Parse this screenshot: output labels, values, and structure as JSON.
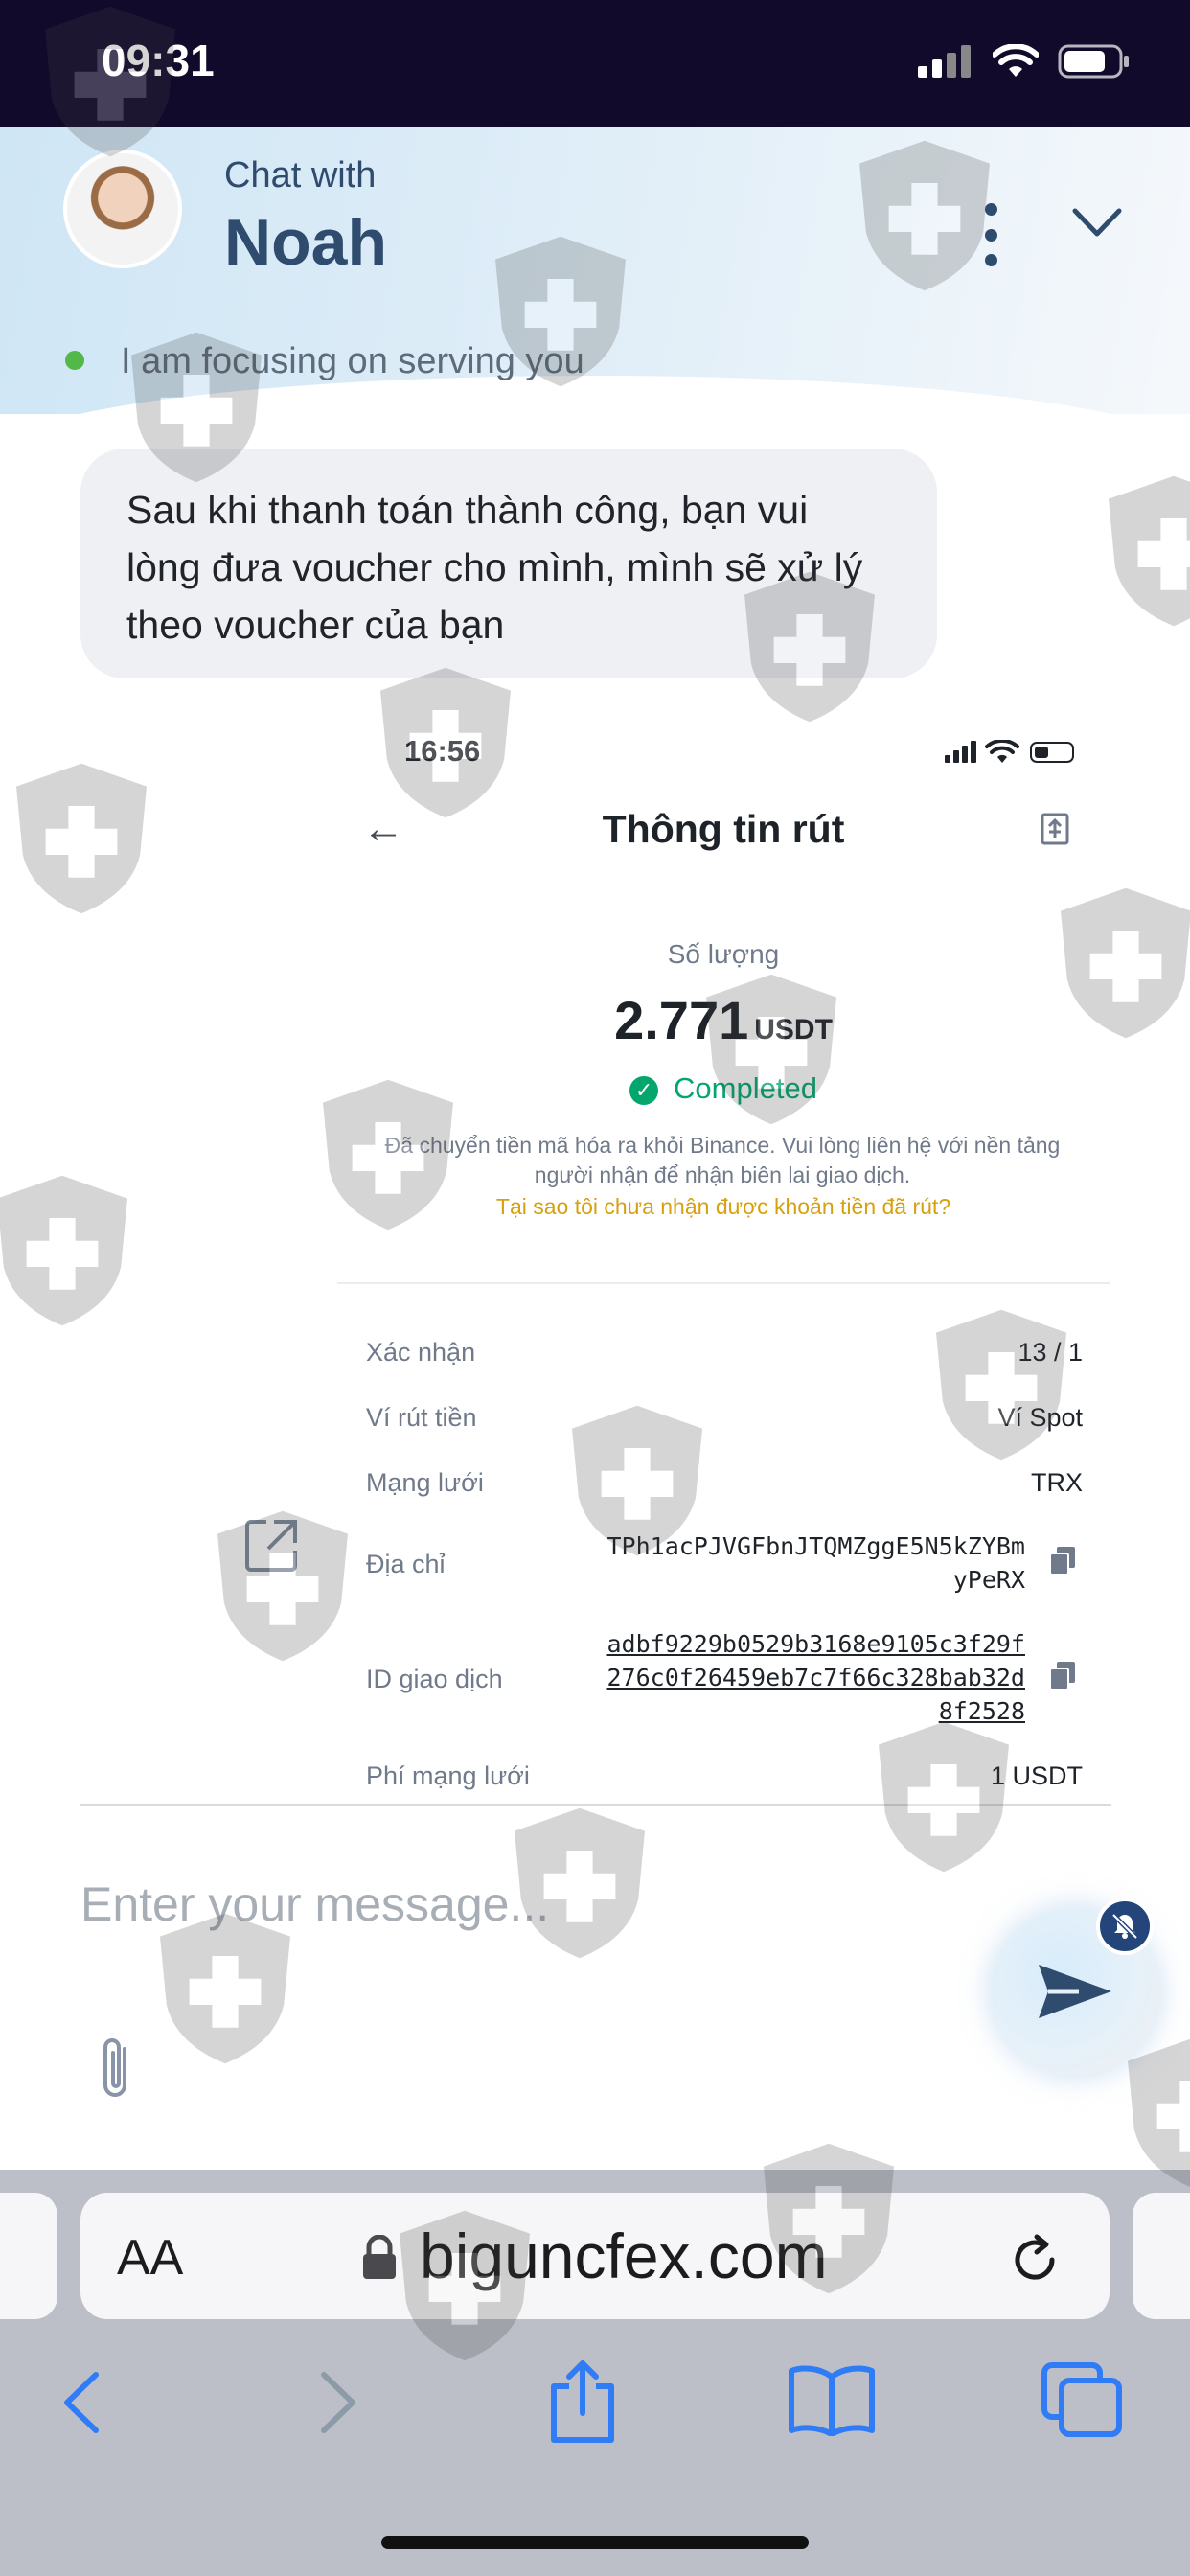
{
  "status_bar": {
    "time": "09:31",
    "icons": [
      "signal-icon",
      "wifi-icon",
      "battery-icon"
    ]
  },
  "chat_header": {
    "chat_with_label": "Chat with",
    "agent_name": "Noah",
    "status_text": "I am focusing on serving you",
    "status_color": "#52b848"
  },
  "message": {
    "text": "Sau khi thanh toán thành công, bạn vui lòng đưa voucher cho mình, mình sẽ xử lý theo voucher của bạn"
  },
  "attached_screenshot": {
    "time": "16:56",
    "title": "Thông tin rút",
    "quantity_label": "Số lượng",
    "quantity_value": "2.771",
    "quantity_unit": "USDT",
    "status": "Completed",
    "note": "Đã chuyển tiền mã hóa ra khỏi Binance. Vui lòng liên hệ với nền tảng người nhận để nhận biên lai giao dịch.",
    "why_link": "Tại sao tôi chưa nhận được khoản tiền đã rút?",
    "details": {
      "confirm_label": "Xác nhận",
      "confirm_value": "13 / 1",
      "wallet_label": "Ví rút tiền",
      "wallet_value": "Ví Spot",
      "network_label": "Mạng lưới",
      "network_value": "TRX",
      "address_label": "Địa chỉ",
      "address_value": "TPh1acPJVGFbnJTQMZggE5N5kZYBmyPeRX",
      "txid_label": "ID giao dịch",
      "txid_value": "adbf9229b0529b3168e9105c3f29f276c0f26459eb7c7f66c328bab32d8f2528",
      "fee_label": "Phí mạng lưới",
      "fee_value": "1 USDT"
    },
    "accent_colors": {
      "completed": "#03a66d",
      "link": "#d6a10e"
    }
  },
  "composer": {
    "placeholder": "Enter your message...",
    "icons": [
      "attach-icon",
      "send-icon",
      "mute-icon"
    ]
  },
  "browser": {
    "text_size_label": "AA",
    "url": "biguncfex.com",
    "icons": [
      "lock-icon",
      "reload-icon"
    ]
  },
  "nav": {
    "icons": [
      "back-icon",
      "forward-icon",
      "share-icon",
      "bookmarks-icon",
      "tabs-icon"
    ],
    "accent": "#2f7cf6"
  }
}
